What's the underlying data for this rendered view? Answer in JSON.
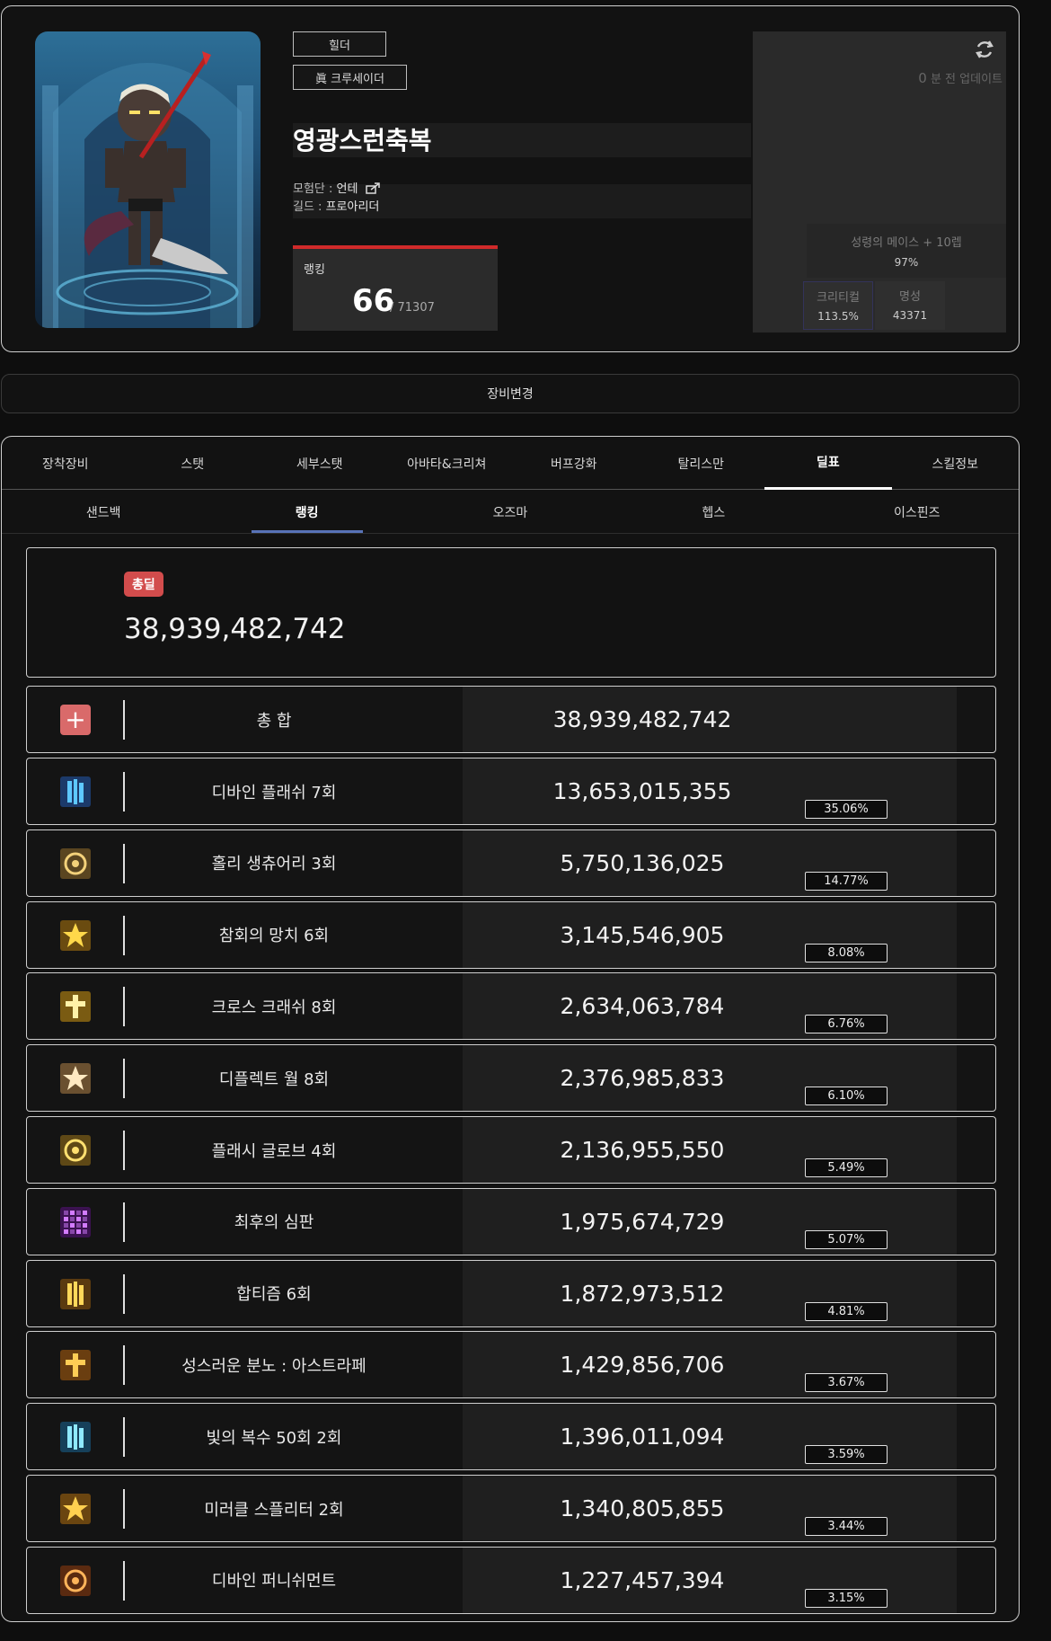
{
  "profile": {
    "server_label": "힐더",
    "job_label": "眞 크루세이더",
    "character_name": "영광스런축복",
    "adventure_label": "모험단 :",
    "adventure_name": "언테",
    "guild_label": "길드 :",
    "guild_name": "프로아리더",
    "ranking_label": "랭킹",
    "rank": "66",
    "rank_total": "/ 71307",
    "update_minutes": "0",
    "update_text": "분 전 업데이트",
    "weapon_name": "성령의 메이스 + 10렙",
    "weapon_pct": "97%",
    "crit_label": "크리티컬",
    "crit_value": "113.5%",
    "fame_label": "명성",
    "fame_value": "43371"
  },
  "equip_change_label": "장비변경",
  "tabs": [
    "장착장비",
    "스탯",
    "세부스탯",
    "아바타&크리쳐",
    "버프강화",
    "탈리스만",
    "딜표",
    "스킬정보"
  ],
  "active_tab": "딜표",
  "subtabs": [
    "샌드백",
    "랭킹",
    "오즈마",
    "헵스",
    "이스핀즈"
  ],
  "active_subtab": "랭킹",
  "total": {
    "badge": "총딜",
    "value": "38,939,482,742"
  },
  "summary_row": {
    "icon": "plus-icon",
    "name": "총 합",
    "value": "38,939,482,742"
  },
  "skills": [
    {
      "icon": "divine-flash-icon",
      "name": "디바인 플래쉬 7회",
      "value": "13,653,015,355",
      "pct": "35.06%"
    },
    {
      "icon": "holy-sanctuary-icon",
      "name": "홀리 생츄어리 3회",
      "value": "5,750,136,025",
      "pct": "14.77%"
    },
    {
      "icon": "hammer-of-repentance-icon",
      "name": "참회의 망치 6회",
      "value": "3,145,546,905",
      "pct": "8.08%"
    },
    {
      "icon": "cross-crash-icon",
      "name": "크로스 크래쉬 8회",
      "value": "2,634,063,784",
      "pct": "6.76%"
    },
    {
      "icon": "deflect-wall-icon",
      "name": "디플렉트 월 8회",
      "value": "2,376,985,833",
      "pct": "6.10%"
    },
    {
      "icon": "flash-globe-icon",
      "name": "플래시 글로브 4회",
      "value": "2,136,955,550",
      "pct": "5.49%"
    },
    {
      "icon": "last-judgement-icon",
      "name": "최후의 심판",
      "value": "1,975,674,729",
      "pct": "5.07%"
    },
    {
      "icon": "hapsism-icon",
      "name": "합티즘 6회",
      "value": "1,872,973,512",
      "pct": "4.81%"
    },
    {
      "icon": "holy-wrath-icon",
      "name": "성스러운 분노 : 아스트라페",
      "value": "1,429,856,706",
      "pct": "3.67%"
    },
    {
      "icon": "vengeance-of-light-icon",
      "name": "빛의 복수 50회 2회",
      "value": "1,396,011,094",
      "pct": "3.59%"
    },
    {
      "icon": "miracle-splitter-icon",
      "name": "미러클 스플리터 2회",
      "value": "1,340,805,855",
      "pct": "3.44%"
    },
    {
      "icon": "divine-punishment-icon",
      "name": "디바인 퍼니쉬먼트",
      "value": "1,227,457,394",
      "pct": "3.15%"
    }
  ],
  "colors": {
    "accent_red": "#d24c4c",
    "subtab_underline": "#5873b8",
    "plus_icon": "#d96a6a"
  }
}
